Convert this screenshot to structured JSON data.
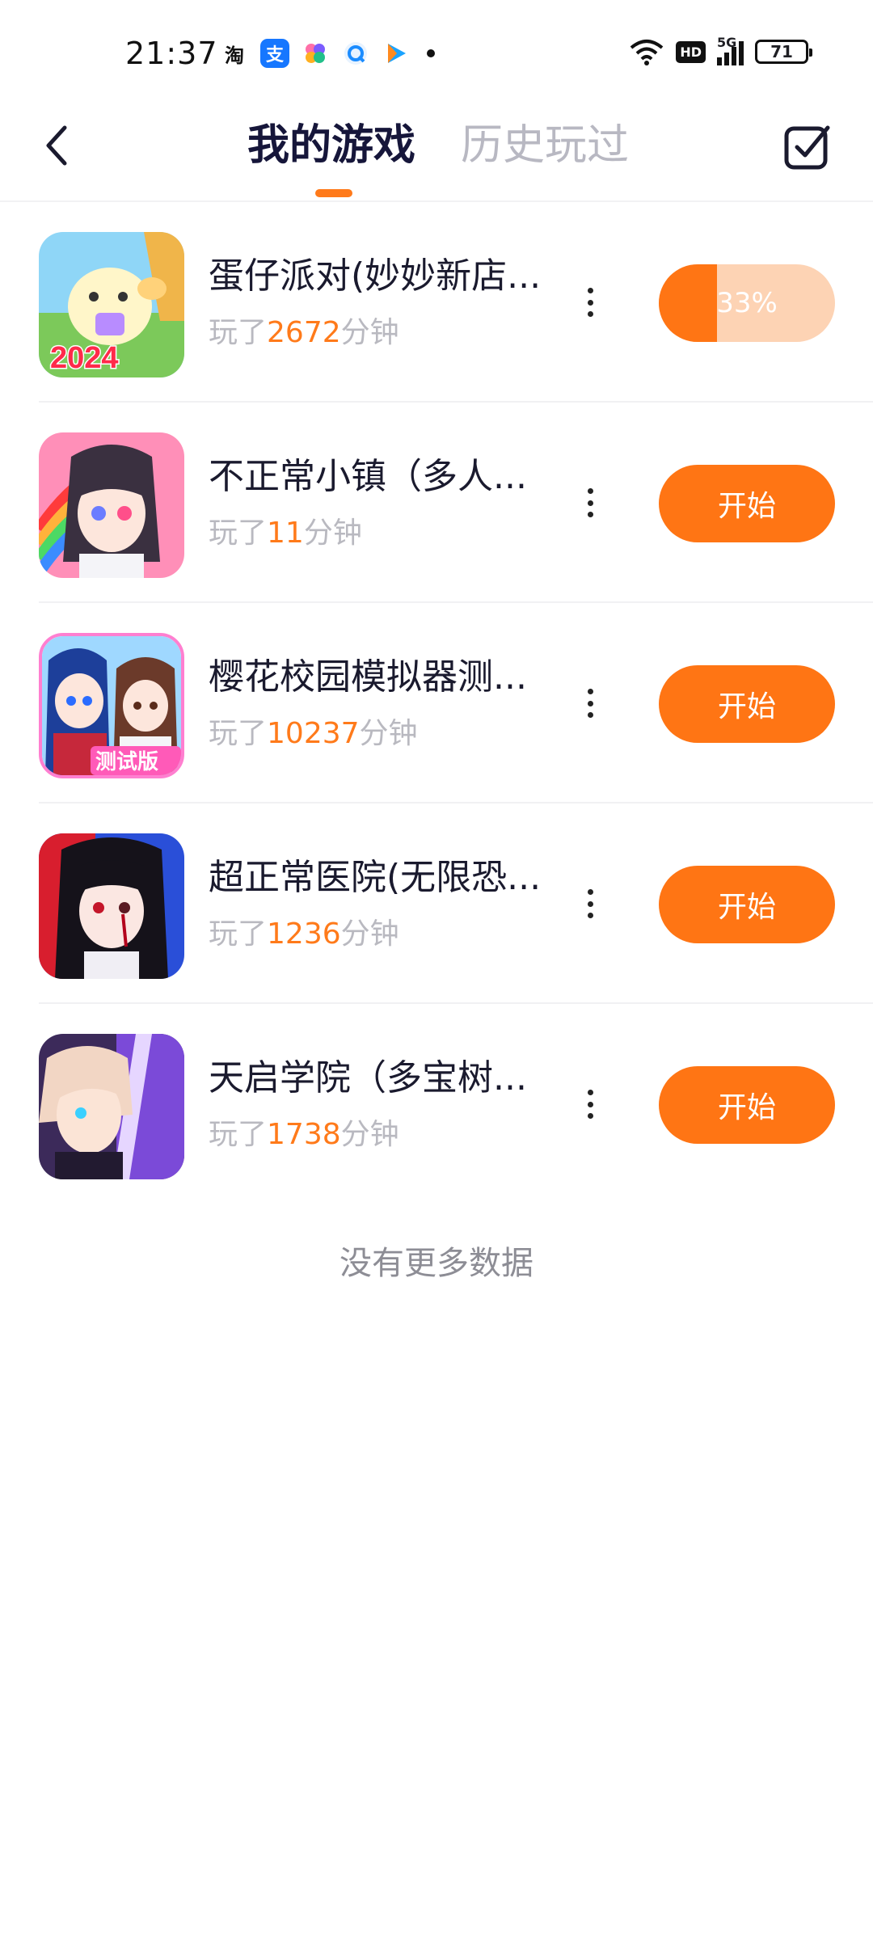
{
  "status": {
    "time": "21:37",
    "taobao_icon_text": "淘",
    "alipay_icon_text": "支",
    "network": "5G",
    "hd": "HD",
    "battery": "71"
  },
  "header": {
    "tab_mine": "我的游戏",
    "tab_history": "历史玩过"
  },
  "colors": {
    "accent": "#ff7514",
    "progress_bg": "#fdd3b4",
    "title": "#16163a",
    "muted": "#b9b9c0"
  },
  "games": [
    {
      "name": "蛋仔派对(妙妙新店...",
      "played_prefix": "玩了",
      "minutes": "2672",
      "played_suffix": "分钟",
      "action": "33%",
      "progress": 0.33,
      "icon": "eggy-party-icon",
      "icon_text": "2024"
    },
    {
      "name": "不正常小镇（多人...",
      "played_prefix": "玩了",
      "minutes": "11",
      "played_suffix": "分钟",
      "action": "开始",
      "icon": "anime-girl-rainbow-icon"
    },
    {
      "name": "樱花校园模拟器测...",
      "played_prefix": "玩了",
      "minutes": "10237",
      "played_suffix": "分钟",
      "action": "开始",
      "icon": "sakura-school-icon",
      "icon_text": "测试版"
    },
    {
      "name": "超正常医院(无限恐...",
      "played_prefix": "玩了",
      "minutes": "1236",
      "played_suffix": "分钟",
      "action": "开始",
      "icon": "hospital-girl-icon"
    },
    {
      "name": "天启学院（多宝树...",
      "played_prefix": "玩了",
      "minutes": "1738",
      "played_suffix": "分钟",
      "action": "开始",
      "icon": "academy-boy-icon"
    }
  ],
  "footer": {
    "no_more": "没有更多数据"
  }
}
